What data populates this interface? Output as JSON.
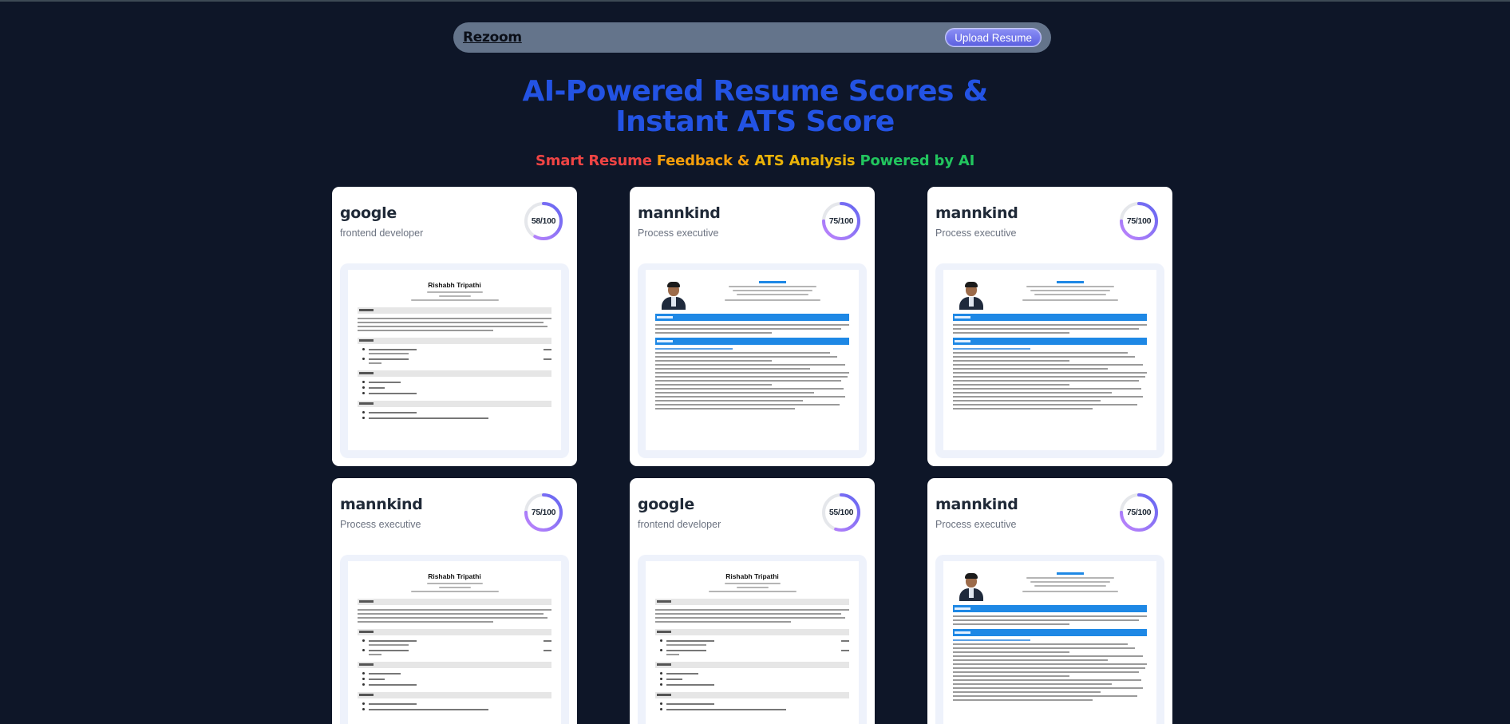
{
  "navbar": {
    "brand": "Rezoom",
    "upload_label": "Upload Resume"
  },
  "hero": {
    "title_line1": "AI-Powered Resume Scores &",
    "title_line2": "Instant ATS Score",
    "subtitle_words": [
      {
        "text": "Smart Resume",
        "color": "#ef4444"
      },
      {
        "text": "Feedback &",
        "color": "#f59e0b"
      },
      {
        "text": "ATS Analysis",
        "color": "#eab308"
      },
      {
        "text": "Powered by AI",
        "color": "#22c55e"
      }
    ]
  },
  "cards": [
    {
      "company": "google",
      "role": "frontend developer",
      "score": 58,
      "score_label": "58/100",
      "resume_template": "plain",
      "resume_name": "Rishabh Tripathi"
    },
    {
      "company": "mannkind",
      "role": "Process executive",
      "score": 75,
      "score_label": "75/100",
      "resume_template": "photo"
    },
    {
      "company": "mannkind",
      "role": "Process executive",
      "score": 75,
      "score_label": "75/100",
      "resume_template": "photo"
    },
    {
      "company": "mannkind",
      "role": "Process executive",
      "score": 75,
      "score_label": "75/100",
      "resume_template": "plain",
      "resume_name": "Rishabh Tripathi"
    },
    {
      "company": "google",
      "role": "frontend developer",
      "score": 55,
      "score_label": "55/100",
      "resume_template": "plain",
      "resume_name": "Rishabh Tripathi"
    },
    {
      "company": "mannkind",
      "role": "Process executive",
      "score": 75,
      "score_label": "75/100",
      "resume_template": "photo"
    }
  ],
  "colors": {
    "background": "#0e1628",
    "accent": "#2353e4",
    "ring_start": "#c084fc",
    "ring_end": "#6366f1"
  }
}
